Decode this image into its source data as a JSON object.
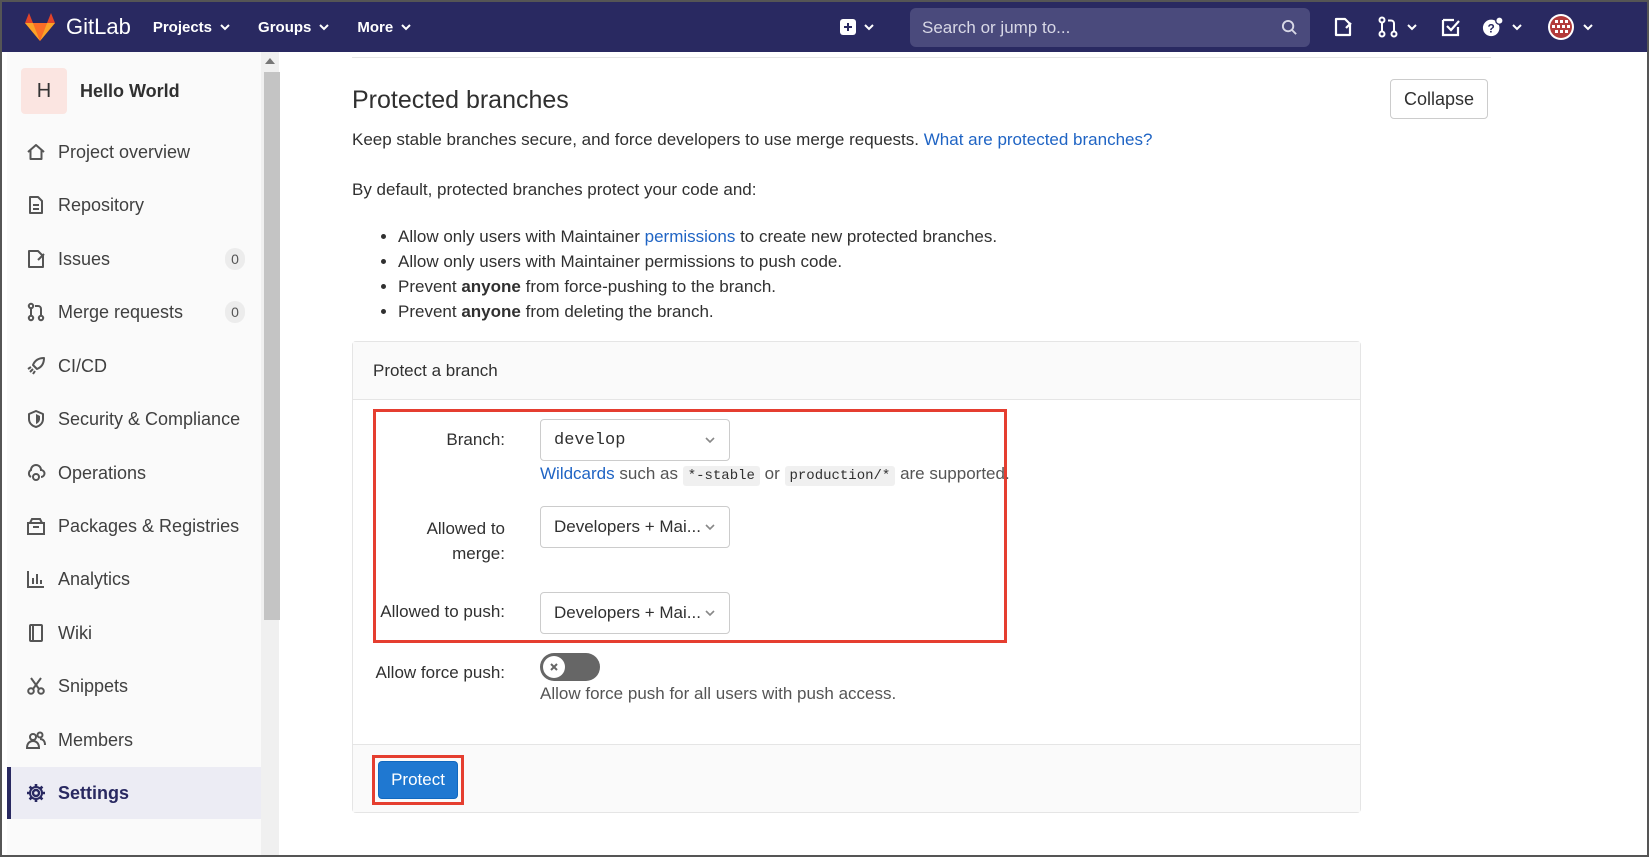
{
  "navbar": {
    "brand": "GitLab",
    "menu": [
      {
        "label": "Projects"
      },
      {
        "label": "Groups"
      },
      {
        "label": "More"
      }
    ],
    "search_placeholder": "Search or jump to..."
  },
  "sidebar": {
    "project_initial": "H",
    "project_name": "Hello World",
    "items": [
      {
        "label": "Project overview",
        "icon": "home-icon"
      },
      {
        "label": "Repository",
        "icon": "file-icon"
      },
      {
        "label": "Issues",
        "icon": "issues-icon",
        "count": "0"
      },
      {
        "label": "Merge requests",
        "icon": "merge-request-icon",
        "count": "0"
      },
      {
        "label": "CI/CD",
        "icon": "rocket-icon"
      },
      {
        "label": "Security & Compliance",
        "icon": "shield-icon"
      },
      {
        "label": "Operations",
        "icon": "cloud-gear-icon"
      },
      {
        "label": "Packages & Registries",
        "icon": "package-icon"
      },
      {
        "label": "Analytics",
        "icon": "chart-icon"
      },
      {
        "label": "Wiki",
        "icon": "book-icon"
      },
      {
        "label": "Snippets",
        "icon": "scissors-icon"
      },
      {
        "label": "Members",
        "icon": "users-icon"
      },
      {
        "label": "Settings",
        "icon": "gear-icon"
      }
    ]
  },
  "main": {
    "title": "Protected branches",
    "collapse_label": "Collapse",
    "description": "Keep stable branches secure, and force developers to use merge requests.",
    "description_link": "What are protected branches?",
    "default_text": "By default, protected branches protect your code and:",
    "rules": {
      "r1_pre": "Allow only users with Maintainer",
      "r1_link": "permissions",
      "r1_post": "to create new protected branches.",
      "r2": "Allow only users with Maintainer permissions to push code.",
      "r3_pre": "Prevent",
      "r3_bold": "anyone",
      "r3_post": "from force-pushing to the branch.",
      "r4_pre": "Prevent",
      "r4_bold": "anyone",
      "r4_post": "from deleting the branch."
    },
    "form": {
      "header": "Protect a branch",
      "branch_label": "Branch:",
      "branch_value": "develop",
      "wildcards_link": "Wildcards",
      "wildcards_text1": "such as",
      "wildcards_code1": "*-stable",
      "wildcards_text2": "or",
      "wildcards_code2": "production/*",
      "wildcards_text3": "are supported.",
      "merge_label_line1": "Allowed to",
      "merge_label_line2": "merge:",
      "merge_value": "Developers + Mai...",
      "push_label": "Allowed to push:",
      "push_value": "Developers + Mai...",
      "force_label": "Allow force push:",
      "force_help": "Allow force push for all users with push access.",
      "force_enabled": false,
      "submit_label": "Protect"
    }
  },
  "colors": {
    "navbar": "#292961",
    "link": "#1f64c4",
    "primary_button": "#1f78d1",
    "highlight": "#e53e30"
  }
}
